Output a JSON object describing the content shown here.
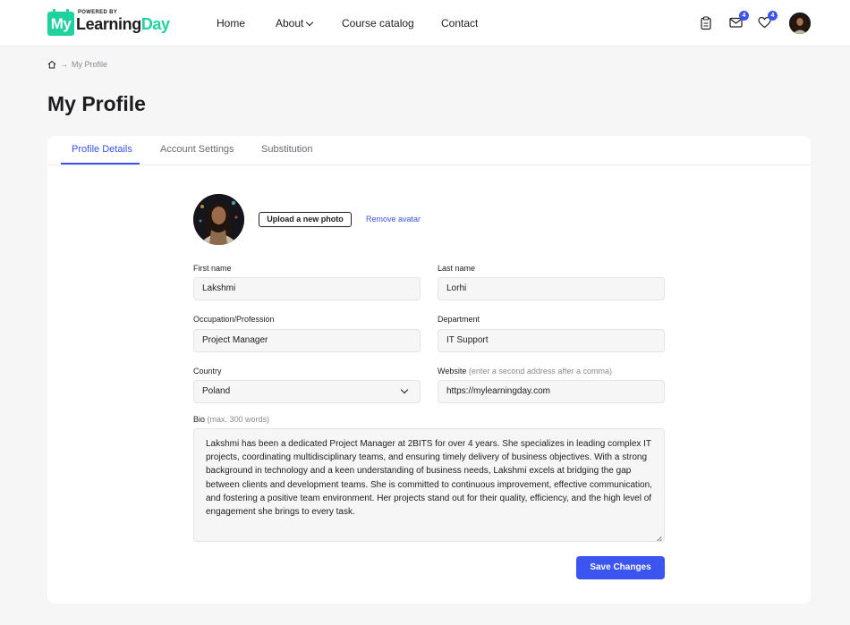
{
  "logo": {
    "powered_by": "POWERED BY",
    "tile": "My",
    "word_dark": "Learning",
    "word_accent": "Day"
  },
  "nav": {
    "home": "Home",
    "about": "About",
    "catalog": "Course catalog",
    "contact": "Contact"
  },
  "header_icons": {
    "clipboard": "clipboard-icon",
    "mail_badge": "4",
    "heart_badge": "4"
  },
  "breadcrumb": {
    "current": "My Profile"
  },
  "page_title": "My Profile",
  "tabs": [
    {
      "label": "Profile Details"
    },
    {
      "label": "Account Settings"
    },
    {
      "label": "Substitution"
    }
  ],
  "profile": {
    "upload_label": "Upload a new photo",
    "remove_label": "Remove avatar",
    "first_name": {
      "label": "First name",
      "value": "Lakshmi"
    },
    "last_name": {
      "label": "Last name",
      "value": "Lorhi"
    },
    "occupation": {
      "label": "Occupation/Profession",
      "value": "Project Manager"
    },
    "department": {
      "label": "Department",
      "value": "IT Support"
    },
    "country": {
      "label": "Country",
      "value": "Poland"
    },
    "website": {
      "label": "Website",
      "hint": "(enter a second address after a comma)",
      "value": "https://mylearningday.com"
    },
    "bio": {
      "label": "Bio",
      "hint": "(max. 300 words)",
      "value": "Lakshmi has been a dedicated Project Manager at 2BITS for over 4 years. She specializes in leading complex IT projects, coordinating multidisciplinary teams, and ensuring timely delivery of business objectives. With a strong background in technology and a keen understanding of business needs, Lakshmi excels at bridging the gap between clients and development teams. She is committed to continuous improvement, effective communication, and fostering a positive team environment. Her projects stand out for their quality, efficiency, and the high level of engagement she brings to every task."
    },
    "save_label": "Save Changes"
  },
  "colors": {
    "accent": "#3d55f0",
    "brand": "#1fd29d",
    "background": "#f6f6f7"
  }
}
